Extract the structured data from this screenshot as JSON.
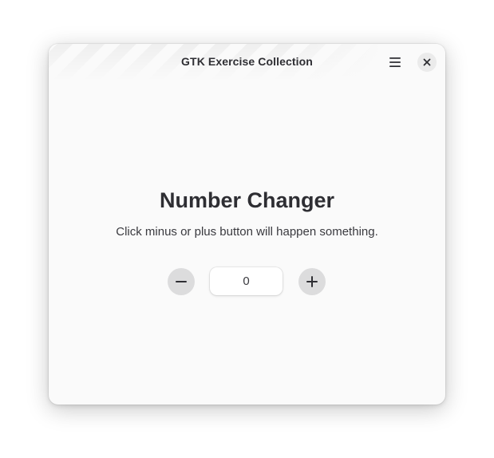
{
  "window": {
    "title": "GTK Exercise Collection",
    "menu_icon": "hamburger-menu-icon",
    "close_icon": "close-icon"
  },
  "content": {
    "title": "Number Changer",
    "subtitle": "Click minus or plus button will happen something.",
    "value": "0",
    "decrement_icon": "minus-icon",
    "increment_icon": "plus-icon"
  },
  "colors": {
    "window_background": "#fafafa",
    "text_primary": "#2e2e33",
    "button_background": "#dcdcdd",
    "field_background": "#ffffff"
  }
}
